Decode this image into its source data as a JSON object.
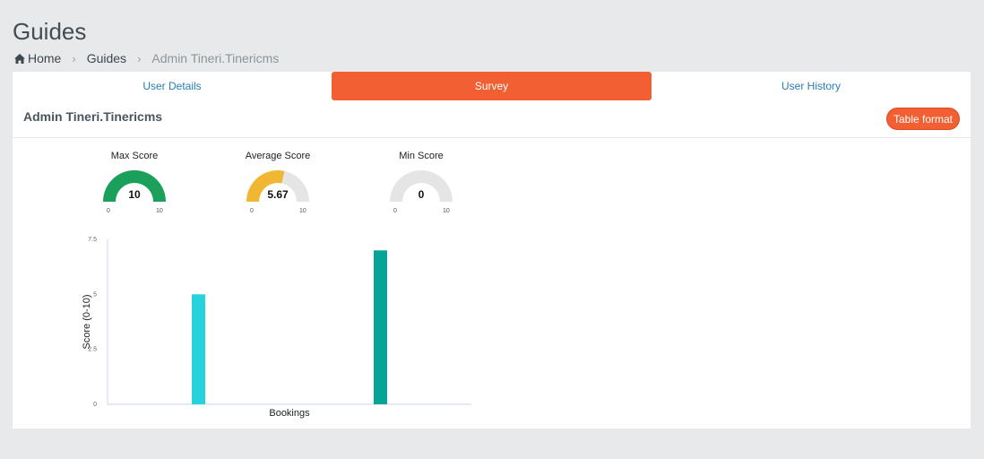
{
  "page": {
    "title": "Guides"
  },
  "breadcrumb": {
    "home": "Home",
    "guides": "Guides",
    "current": "Admin Tineri.Tinericms"
  },
  "tabs": [
    {
      "label": "User Details",
      "active": false
    },
    {
      "label": "Survey",
      "active": true
    },
    {
      "label": "User History",
      "active": false
    }
  ],
  "user": {
    "name": "Admin Tineri.Tinericms"
  },
  "actions": {
    "table_format": "Table format"
  },
  "gauges": [
    {
      "title": "Max Score",
      "value": "10",
      "fraction": 1.0,
      "min": "0",
      "max": "10",
      "color": "#1aa05a"
    },
    {
      "title": "Average Score",
      "value": "5.67",
      "fraction": 0.567,
      "min": "0",
      "max": "10",
      "color": "#f2b732"
    },
    {
      "title": "Min Score",
      "value": "0",
      "fraction": 0.0,
      "min": "0",
      "max": "10",
      "color": "#1aa05a"
    }
  ],
  "colors": {
    "accent": "#f15f33",
    "link": "#2a7db5",
    "gauge_track": "#e5e5e5"
  },
  "chart_data": {
    "type": "bar",
    "xlabel": "Bookings",
    "ylabel": "Score (0-10)",
    "ylim": [
      0,
      7.5
    ],
    "yticks": [
      "0",
      "2.5",
      "5",
      "7.5"
    ],
    "grid": false,
    "series": [
      {
        "values": [
          5
        ],
        "color": "#26d2dc"
      },
      {
        "values": [
          7
        ],
        "color": "#06a497"
      }
    ]
  }
}
